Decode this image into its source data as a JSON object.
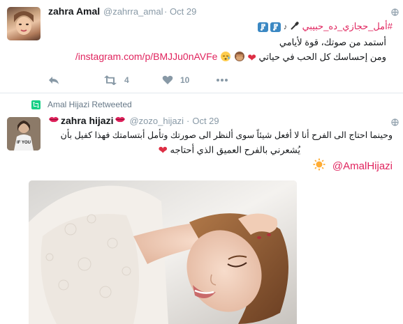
{
  "tweet1": {
    "name": "zahra Amal",
    "handle": "@zahrra_amal",
    "separator": "·",
    "time": "Oct 29",
    "hashtag": "#أمل_حجازي_ده_حبيبي",
    "line2": "أستمد من صوتك، قوة لأيامي",
    "link": "instagram.com/p/BMJJu0nAVFe/",
    "line3": "ومن إحساسك كل الحب في حياتي",
    "retweet_count": "4",
    "like_count": "10",
    "icons": [
      "microphone-icon",
      "musical-note-icon",
      "musical-note-icon",
      "globe-icon",
      "reply-icon",
      "retweet-icon",
      "heart-icon",
      "more-icon",
      "red-heart-emoji",
      "see-no-evil-monkey-emoji",
      "sleepy-face-emoji"
    ]
  },
  "tweet2": {
    "retweeted_by": "Amal Hijazi Retweeted",
    "name": "zahra hijazi",
    "handle": "@zozo_hijazi",
    "separator": "·",
    "time": "Oct 29",
    "line1": "وحينما احتاج الى الفرح أنا لا أفعل شيئاً سوى ألنظر الى صورتك  وتأمل أبتسامتك فهذا كفيل بأن",
    "line2": "يُشعرني بالفرح العميق الذي أحتاجه",
    "mention": "@AmalHijazi",
    "icons": [
      "retweet-badge-icon",
      "lips-emoji",
      "globe-icon",
      "red-heart-emoji",
      "sun-emoji",
      "photo-image"
    ]
  },
  "colors": {
    "accent": "#e0245e",
    "muted": "#8899a6",
    "retweet_green": "#19cf86",
    "text": "#14171a"
  }
}
